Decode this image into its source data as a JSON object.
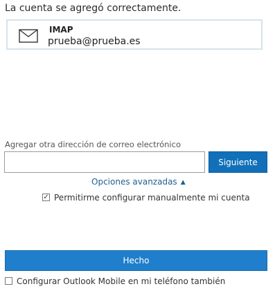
{
  "header": {
    "success_message": "La cuenta se agregó correctamente."
  },
  "account": {
    "icon": "envelope-icon",
    "type": "IMAP",
    "email": "prueba@prueba.es"
  },
  "add_account": {
    "label": "Agregar otra dirección de correo electrónico",
    "input_value": "",
    "next_button": "Siguiente"
  },
  "advanced": {
    "link_label": "Opciones avanzadas",
    "chevron": "▲"
  },
  "manual_setup": {
    "checked": true,
    "check_glyph": "✓",
    "label": "Permitirme configurar manualmente mi cuenta"
  },
  "done_button": "Hecho",
  "mobile_setup": {
    "checked": false,
    "label": "Configurar Outlook Mobile en mi teléfono también"
  },
  "colors": {
    "primary_button": "#1170b9",
    "done_button": "#1f7fcc",
    "card_border": "#d3e3ec",
    "link": "#1e5f8f"
  }
}
